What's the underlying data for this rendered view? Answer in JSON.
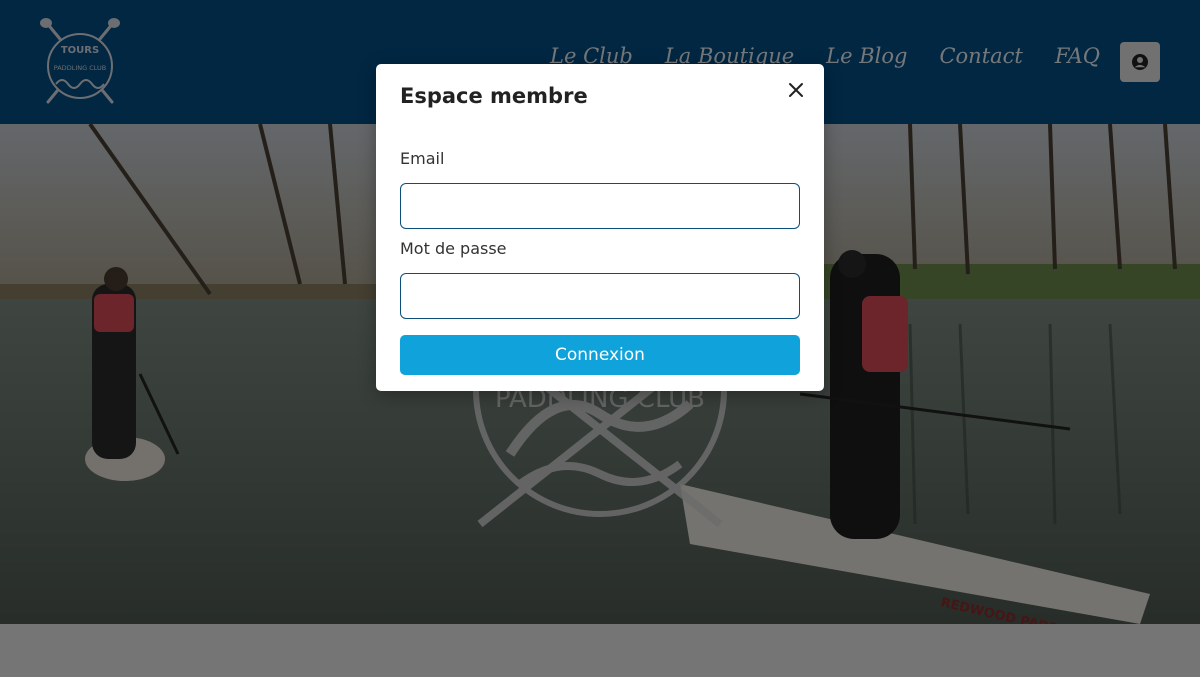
{
  "header": {
    "logo": {
      "top_text": "TOURS",
      "bottom_text": "PADDLING CLUB"
    },
    "nav": [
      "Le Club",
      "La Boutique",
      "Le Blog",
      "Contact",
      "FAQ"
    ],
    "account_icon": "user-circle-icon"
  },
  "hero": {
    "watermark_text": "PADDLING CLUB",
    "board_text": "REDWOOD PADDLE"
  },
  "modal": {
    "title": "Espace membre",
    "close_icon": "close-icon",
    "email_label": "Email",
    "email_value": "",
    "password_label": "Mot de passe",
    "password_value": "",
    "submit_label": "Connexion"
  },
  "colors": {
    "navbar": "#034e86",
    "input_border": "#0b4f7c",
    "button": "#10a3db",
    "overlay": "rgba(0,0,0,0.5)"
  }
}
